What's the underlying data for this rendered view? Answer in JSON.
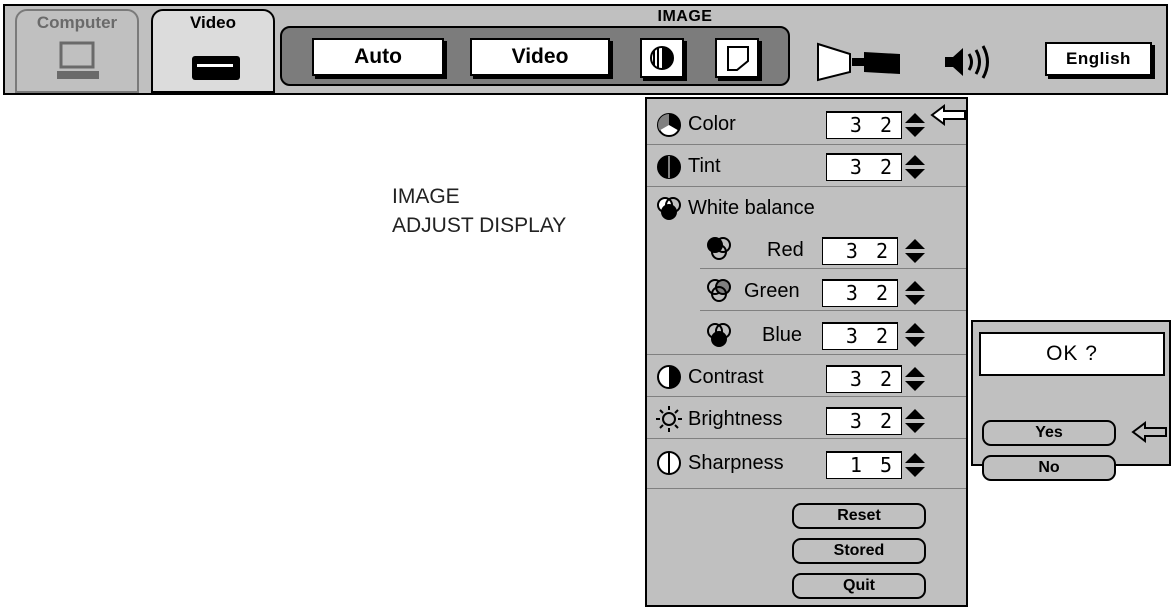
{
  "menu": {
    "tabs": [
      {
        "label": "Computer",
        "icon": "monitor-icon"
      },
      {
        "label": "Video",
        "icon": "vcr-icon"
      }
    ],
    "title": "IMAGE",
    "mode_buttons": [
      "Auto",
      "Video"
    ],
    "language": "English"
  },
  "caption": {
    "line1": "IMAGE",
    "line2": "ADJUST DISPLAY"
  },
  "adjust": {
    "rows": [
      {
        "label": "Color",
        "value": "3 2"
      },
      {
        "label": "Tint",
        "value": "3 2"
      },
      {
        "label": "White balance"
      },
      {
        "label": "Red",
        "value": "3 2"
      },
      {
        "label": "Green",
        "value": "3 2"
      },
      {
        "label": "Blue",
        "value": "3 2"
      },
      {
        "label": "Contrast",
        "value": "3 2"
      },
      {
        "label": "Brightness",
        "value": "3 2"
      },
      {
        "label": "Sharpness",
        "value": "1 5"
      }
    ],
    "buttons": [
      "Reset",
      "Stored",
      "Quit"
    ]
  },
  "dialog": {
    "prompt": "OK ?",
    "yes": "Yes",
    "no": "No"
  },
  "colors": {
    "panel": "#c0c0c0",
    "dark_panel": "#7c7c7c"
  }
}
